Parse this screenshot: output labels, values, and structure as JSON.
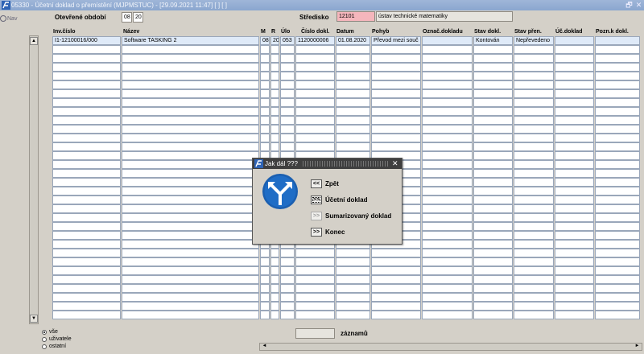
{
  "window": {
    "title": "05330 - Účetní doklad o přemístění (MJPMSTUC) - [29.09.2021 11:47] [ ] [ ]",
    "restore_glyph": "🗗",
    "close_glyph": "✕"
  },
  "nav": {
    "label": "Nav"
  },
  "header": {
    "period_label": "Otevřené období",
    "period_month": "08",
    "period_year": "20",
    "center_label": "Středisko",
    "center_code": "12101",
    "center_name": "ústav technické matematiky"
  },
  "table": {
    "columns": [
      "Inv.číslo",
      "Název",
      "M",
      "R",
      "Úlo",
      "Číslo dokl.",
      "Datum",
      "Pohyb",
      "Označ.dokladu",
      "Stav dokl.",
      "Stav přen.",
      "Úč.doklad",
      "Pozn.k dokl."
    ],
    "rows": [
      [
        "I1-12100016/000",
        "Software TASKING 2",
        "08",
        "20",
        "053",
        "1120000006",
        "01.08.2020",
        "Převod mezi souč",
        "",
        "Kontován",
        "Nepřevedeno",
        "",
        ""
      ]
    ]
  },
  "scroll": {
    "up": "▲",
    "down": "▼",
    "left": "◄",
    "right": "►"
  },
  "filter": {
    "options": [
      {
        "label": "vše",
        "selected": true
      },
      {
        "label": "uživatele",
        "selected": false
      },
      {
        "label": "ostatní",
        "selected": false
      }
    ]
  },
  "records": {
    "count": "",
    "label": "záznamů"
  },
  "dialog": {
    "title": "Jak dál ???",
    "close_glyph": "✕",
    "buttons": [
      {
        "symbol": "<<",
        "label": "Zpět",
        "enabled": true
      },
      {
        "symbol": ">>",
        "label": "Účetní doklad",
        "enabled": true
      },
      {
        "symbol": ">>",
        "label": "Sumarizovaný doklad",
        "enabled": false
      },
      {
        "symbol": ">>",
        "label": "Konec",
        "enabled": true
      }
    ]
  }
}
